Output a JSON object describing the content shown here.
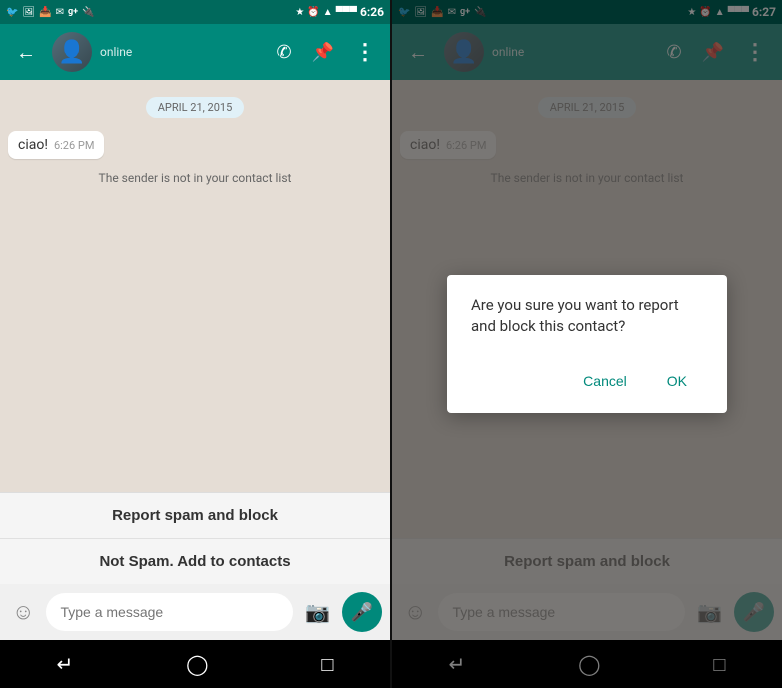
{
  "screen_left": {
    "status_bar": {
      "time": "6:26",
      "left_icons": [
        "🐦",
        "🖼",
        "📥",
        "✉",
        "g+",
        "🔋"
      ],
      "right_icons": [
        "🔵",
        "⏰",
        "📶",
        "📡",
        "🔋"
      ]
    },
    "app_bar": {
      "back_label": "←",
      "contact_name": "online",
      "phone_icon": "phone-icon",
      "attach_icon": "attach-icon",
      "more_icon": "more-icon"
    },
    "chat": {
      "date": "APRIL 21, 2015",
      "message_text": "ciao!",
      "message_time": "6:26 PM",
      "sender_warning": "The sender is not in your contact list"
    },
    "spam_section": {
      "report_spam_label": "Report spam and block",
      "not_spam_label": "Not Spam. Add to contacts"
    },
    "input": {
      "placeholder": "Type a message",
      "emoji_icon": "emoji-icon",
      "camera_icon": "camera-icon",
      "mic_icon": "mic-icon"
    },
    "nav_bar": {
      "back_icon": "nav-back-icon",
      "home_icon": "nav-home-icon",
      "recents_icon": "nav-recents-icon"
    }
  },
  "screen_right": {
    "status_bar": {
      "time": "6:27"
    },
    "app_bar": {
      "back_label": "←",
      "contact_name": "online"
    },
    "chat": {
      "date": "APRIL 21, 2015",
      "message_text": "ciao!",
      "message_time": "6:26 PM",
      "sender_warning": "The sender is not in your contact list"
    },
    "spam_section": {
      "report_spam_label": "Report spam and block"
    },
    "dialog": {
      "title": "Are you sure you want to report and block this contact?",
      "cancel_label": "Cancel",
      "ok_label": "OK"
    },
    "input": {
      "placeholder": "Type a message"
    },
    "nav_bar": {
      "back_icon": "nav-back-icon",
      "home_icon": "nav-home-icon",
      "recents_icon": "nav-recents-icon"
    }
  }
}
